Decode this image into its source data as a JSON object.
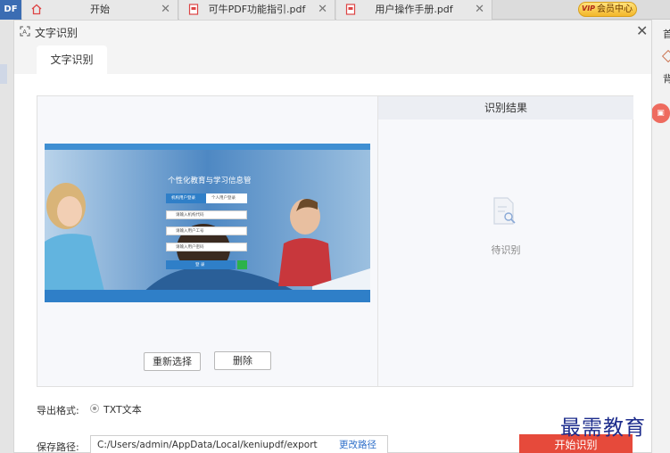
{
  "app": {
    "logo": "DF"
  },
  "tabs": [
    {
      "label": "开始",
      "icon": "home-icon"
    },
    {
      "label": "可牛PDF功能指引.pdf",
      "icon": "pdf-file-icon"
    },
    {
      "label": "用户操作手册.pdf",
      "icon": "pdf-file-icon"
    }
  ],
  "vip": {
    "tag": "VIP",
    "label": "会员中心"
  },
  "right_strip": {
    "t1": "首",
    "t2": "背"
  },
  "dialog": {
    "title": "文字识别",
    "tab": "文字识别",
    "result_header": "识别结果",
    "empty_text": "待识别",
    "preview": {
      "title": "个性化教育与学习信息管",
      "tab1": "机构用户登录",
      "tab2": "个人用户登录",
      "field1": "请输入机构代码",
      "field2": "请输入用户工号",
      "field3": "请输入用户密码",
      "submit": "登 录"
    },
    "buttons": {
      "reselect": "重新选择",
      "delete": "删除"
    },
    "export_label": "导出格式:",
    "export_option": "TXT文本",
    "path_label": "保存路径:",
    "path_value": "C:/Users/admin/AppData/Local/keniupdf/export",
    "change_path": "更改路径",
    "start": "开始识别"
  },
  "watermark": "最需教育",
  "colors": {
    "accent": "#e64a3b",
    "link": "#2d6ec9"
  }
}
